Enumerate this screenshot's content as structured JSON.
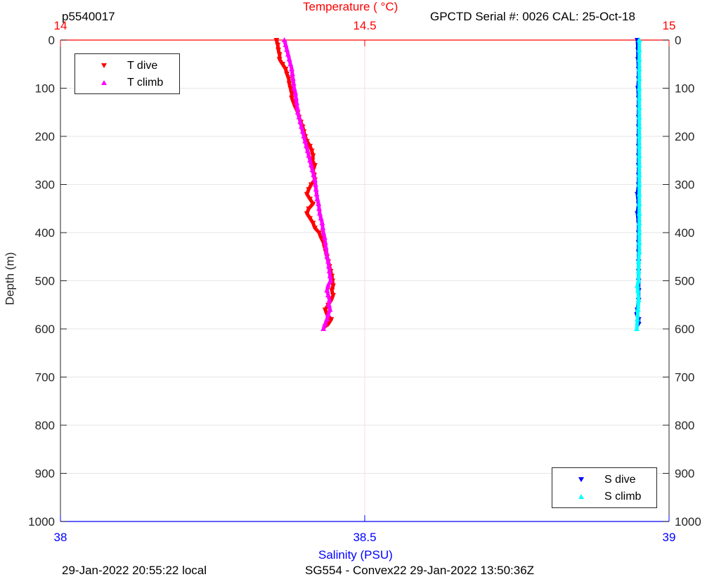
{
  "header": {
    "profile_id": "p5540017",
    "instrument": "GPCTD Serial #: 0026 CAL: 25-Oct-18"
  },
  "footer": {
    "local_time": "29-Jan-2022 20:55:22 local",
    "mission": "SG554 - Convex22 29-Jan-2022 13:50:36Z"
  },
  "colors": {
    "t_dive": "#ff0000",
    "t_climb": "#ff00ff",
    "s_dive": "#0000ff",
    "s_climb": "#00ffff",
    "temp_axis": "#ff0000",
    "sal_axis": "#0000ff",
    "axis": "#262626"
  },
  "chart_data": {
    "type": "scatter",
    "ylabel": "Depth (m)",
    "y_reversed": true,
    "ylim": [
      0,
      1000
    ],
    "y_ticks": [
      "0",
      "100",
      "200",
      "300",
      "400",
      "500",
      "600",
      "700",
      "800",
      "900",
      "1000"
    ],
    "temperature_axis": {
      "label": "Temperature (    °C)",
      "position": "top",
      "lim": [
        14,
        15
      ],
      "ticks": [
        "14",
        "14.5",
        "15"
      ]
    },
    "salinity_axis": {
      "label": "Salinity (PSU)",
      "position": "bottom",
      "lim": [
        38,
        39
      ],
      "ticks": [
        "38",
        "38.5",
        "39"
      ]
    },
    "grid": true,
    "legends": [
      {
        "placement": "top-left",
        "entries": [
          "T dive",
          "T climb"
        ]
      },
      {
        "placement": "bottom-right",
        "entries": [
          "S dive",
          "S climb"
        ]
      }
    ],
    "series": [
      {
        "name": "T dive",
        "axis": "temperature",
        "marker": "triangle-down",
        "points": [
          [
            0,
            14.355
          ],
          [
            10,
            14.357
          ],
          [
            20,
            14.358
          ],
          [
            30,
            14.36
          ],
          [
            40,
            14.36
          ],
          [
            50,
            14.365
          ],
          [
            60,
            14.37
          ],
          [
            70,
            14.372
          ],
          [
            80,
            14.375
          ],
          [
            90,
            14.376
          ],
          [
            100,
            14.378
          ],
          [
            110,
            14.38
          ],
          [
            120,
            14.38
          ],
          [
            130,
            14.383
          ],
          [
            140,
            14.386
          ],
          [
            150,
            14.39
          ],
          [
            160,
            14.392
          ],
          [
            170,
            14.395
          ],
          [
            180,
            14.398
          ],
          [
            190,
            14.4
          ],
          [
            200,
            14.402
          ],
          [
            210,
            14.405
          ],
          [
            220,
            14.41
          ],
          [
            230,
            14.413
          ],
          [
            240,
            14.415
          ],
          [
            250,
            14.414
          ],
          [
            260,
            14.418
          ],
          [
            270,
            14.415
          ],
          [
            280,
            14.417
          ],
          [
            290,
            14.418
          ],
          [
            300,
            14.412
          ],
          [
            310,
            14.408
          ],
          [
            320,
            14.405
          ],
          [
            330,
            14.41
          ],
          [
            340,
            14.415
          ],
          [
            350,
            14.408
          ],
          [
            360,
            14.405
          ],
          [
            370,
            14.41
          ],
          [
            380,
            14.415
          ],
          [
            390,
            14.418
          ],
          [
            400,
            14.425
          ],
          [
            410,
            14.428
          ],
          [
            420,
            14.432
          ],
          [
            430,
            14.434
          ],
          [
            440,
            14.436
          ],
          [
            450,
            14.438
          ],
          [
            460,
            14.44
          ],
          [
            470,
            14.442
          ],
          [
            480,
            14.444
          ],
          [
            490,
            14.446
          ],
          [
            500,
            14.447
          ],
          [
            510,
            14.448
          ],
          [
            520,
            14.446
          ],
          [
            530,
            14.448
          ],
          [
            540,
            14.445
          ],
          [
            550,
            14.44
          ],
          [
            560,
            14.435
          ],
          [
            570,
            14.438
          ],
          [
            580,
            14.445
          ],
          [
            590,
            14.44
          ],
          [
            595,
            14.435
          ]
        ]
      },
      {
        "name": "T climb",
        "axis": "temperature",
        "marker": "triangle-up",
        "points": [
          [
            0,
            14.368
          ],
          [
            10,
            14.37
          ],
          [
            20,
            14.372
          ],
          [
            30,
            14.374
          ],
          [
            40,
            14.376
          ],
          [
            50,
            14.378
          ],
          [
            60,
            14.38
          ],
          [
            70,
            14.381
          ],
          [
            80,
            14.382
          ],
          [
            90,
            14.383
          ],
          [
            100,
            14.384
          ],
          [
            110,
            14.386
          ],
          [
            120,
            14.387
          ],
          [
            130,
            14.388
          ],
          [
            140,
            14.389
          ],
          [
            150,
            14.39
          ],
          [
            160,
            14.392
          ],
          [
            170,
            14.394
          ],
          [
            180,
            14.396
          ],
          [
            190,
            14.398
          ],
          [
            200,
            14.4
          ],
          [
            210,
            14.402
          ],
          [
            220,
            14.404
          ],
          [
            230,
            14.406
          ],
          [
            240,
            14.408
          ],
          [
            250,
            14.41
          ],
          [
            260,
            14.412
          ],
          [
            270,
            14.414
          ],
          [
            280,
            14.416
          ],
          [
            290,
            14.418
          ],
          [
            300,
            14.419
          ],
          [
            310,
            14.42
          ],
          [
            320,
            14.421
          ],
          [
            330,
            14.422
          ],
          [
            340,
            14.424
          ],
          [
            350,
            14.425
          ],
          [
            360,
            14.426
          ],
          [
            370,
            14.428
          ],
          [
            380,
            14.43
          ],
          [
            390,
            14.431
          ],
          [
            400,
            14.432
          ],
          [
            410,
            14.434
          ],
          [
            420,
            14.435
          ],
          [
            430,
            14.436
          ],
          [
            440,
            14.437
          ],
          [
            450,
            14.438
          ],
          [
            460,
            14.44
          ],
          [
            470,
            14.441
          ],
          [
            480,
            14.442
          ],
          [
            490,
            14.443
          ],
          [
            500,
            14.444
          ],
          [
            510,
            14.44
          ],
          [
            520,
            14.438
          ],
          [
            530,
            14.44
          ],
          [
            540,
            14.442
          ],
          [
            550,
            14.441
          ],
          [
            560,
            14.443
          ],
          [
            570,
            14.44
          ],
          [
            580,
            14.438
          ],
          [
            590,
            14.435
          ],
          [
            600,
            14.432
          ]
        ]
      },
      {
        "name": "S dive",
        "axis": "salinity",
        "marker": "triangle-down",
        "points": [
          [
            0,
            38.948
          ],
          [
            20,
            38.949
          ],
          [
            40,
            38.949
          ],
          [
            60,
            38.95
          ],
          [
            80,
            38.95
          ],
          [
            100,
            38.949
          ],
          [
            120,
            38.95
          ],
          [
            140,
            38.95
          ],
          [
            160,
            38.95
          ],
          [
            180,
            38.95
          ],
          [
            200,
            38.95
          ],
          [
            220,
            38.95
          ],
          [
            240,
            38.95
          ],
          [
            260,
            38.95
          ],
          [
            280,
            38.95
          ],
          [
            300,
            38.95
          ],
          [
            320,
            38.948
          ],
          [
            340,
            38.95
          ],
          [
            360,
            38.948
          ],
          [
            380,
            38.95
          ],
          [
            400,
            38.95
          ],
          [
            420,
            38.95
          ],
          [
            440,
            38.95
          ],
          [
            460,
            38.95
          ],
          [
            480,
            38.95
          ],
          [
            500,
            38.95
          ],
          [
            520,
            38.95
          ],
          [
            540,
            38.95
          ],
          [
            560,
            38.948
          ],
          [
            570,
            38.947
          ],
          [
            580,
            38.95
          ],
          [
            590,
            38.95
          ]
        ]
      },
      {
        "name": "S climb",
        "axis": "salinity",
        "marker": "triangle-up",
        "points": [
          [
            0,
            38.951
          ],
          [
            20,
            38.951
          ],
          [
            40,
            38.951
          ],
          [
            60,
            38.951
          ],
          [
            80,
            38.951
          ],
          [
            100,
            38.951
          ],
          [
            120,
            38.951
          ],
          [
            140,
            38.951
          ],
          [
            160,
            38.951
          ],
          [
            180,
            38.951
          ],
          [
            200,
            38.951
          ],
          [
            220,
            38.951
          ],
          [
            240,
            38.951
          ],
          [
            260,
            38.951
          ],
          [
            280,
            38.951
          ],
          [
            300,
            38.951
          ],
          [
            320,
            38.951
          ],
          [
            340,
            38.951
          ],
          [
            360,
            38.951
          ],
          [
            380,
            38.951
          ],
          [
            400,
            38.951
          ],
          [
            420,
            38.951
          ],
          [
            440,
            38.951
          ],
          [
            460,
            38.95
          ],
          [
            480,
            38.95
          ],
          [
            500,
            38.95
          ],
          [
            510,
            38.948
          ],
          [
            520,
            38.949
          ],
          [
            540,
            38.95
          ],
          [
            560,
            38.949
          ],
          [
            580,
            38.948
          ],
          [
            600,
            38.947
          ]
        ]
      }
    ]
  }
}
